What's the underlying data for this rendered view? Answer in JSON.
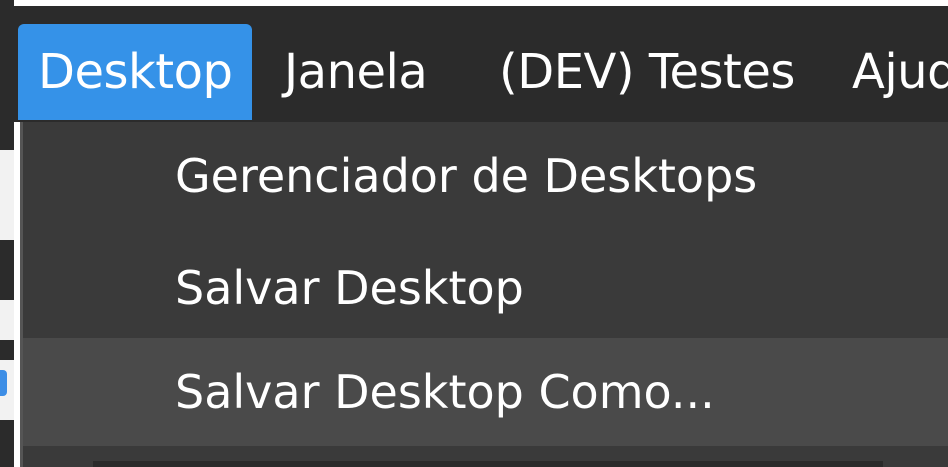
{
  "menubar": {
    "items": [
      {
        "label": "Desktop",
        "active": true
      },
      {
        "label": "Janela"
      },
      {
        "label": "(DEV) Testes"
      },
      {
        "label": "Ajud"
      }
    ]
  },
  "dropdown": {
    "items": [
      {
        "label": "Gerenciador de Desktops"
      },
      {
        "label": "Salvar Desktop"
      },
      {
        "label": "Salvar Desktop Como...",
        "highlighted": true
      }
    ]
  },
  "colors": {
    "accent": "#3592e8",
    "menu_bg": "#2b2b2b",
    "dropdown_bg": "#3a3a3a",
    "hover_bg": "#4a4a4a"
  }
}
